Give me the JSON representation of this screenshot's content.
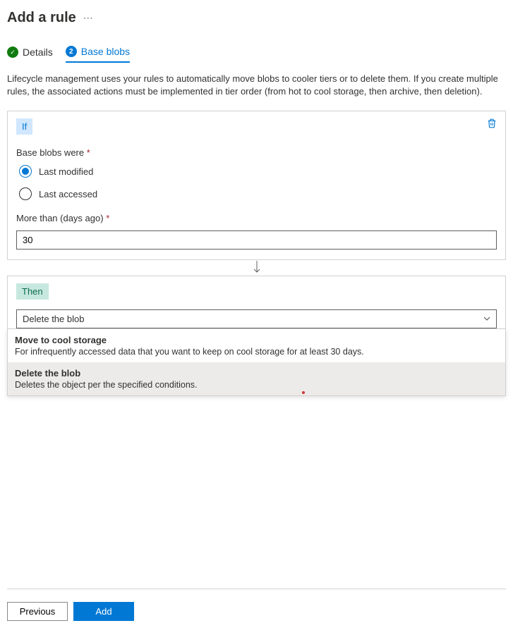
{
  "header": {
    "title": "Add a rule"
  },
  "tabs": {
    "details": {
      "label": "Details",
      "icon": "check"
    },
    "baseblobs": {
      "label": "Base blobs",
      "number": "2"
    }
  },
  "description": "Lifecycle management uses your rules to automatically move blobs to cooler tiers or to delete them. If you create multiple rules, the associated actions must be implemented in tier order (from hot to cool storage, then archive, then deletion).",
  "if_block": {
    "badge": "If",
    "condition_label": "Base blobs were",
    "radios": {
      "last_modified": "Last modified",
      "last_accessed": "Last accessed"
    },
    "days_label": "More than (days ago)",
    "days_value": "30"
  },
  "then_block": {
    "badge": "Then",
    "selected": "Delete the blob",
    "options": [
      {
        "title": "Move to cool storage",
        "desc": "For infrequently accessed data that you want to keep on cool storage for at least 30 days."
      },
      {
        "title": "Delete the blob",
        "desc": "Deletes the object per the specified conditions."
      }
    ]
  },
  "footer": {
    "previous": "Previous",
    "add": "Add"
  }
}
